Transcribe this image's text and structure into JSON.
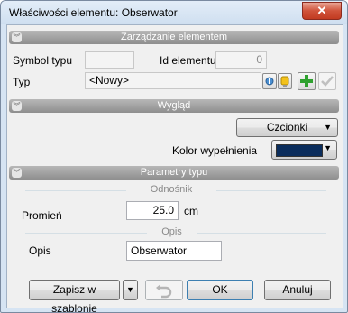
{
  "window": {
    "title": "Właściwości elementu: Obserwator",
    "close_symbol": "✕"
  },
  "sections": {
    "management": "Zarządzanie elementem",
    "appearance": "Wygląd",
    "params": "Parametry typu"
  },
  "management": {
    "type_symbol_label": "Symbol typu",
    "type_symbol_value": "",
    "element_id_label": "Id elementu",
    "element_id_value": "0",
    "type_label": "Typ",
    "type_value": "<Nowy>"
  },
  "appearance": {
    "fonts_button": "Czcionki",
    "fill_color_label": "Kolor wypełnienia",
    "fill_color": "#0b2d5c"
  },
  "params": {
    "reference_group": "Odnośnik",
    "radius_label": "Promień",
    "radius_value": "25.0",
    "radius_unit": "cm",
    "description_group": "Opis",
    "description_label": "Opis",
    "description_value": "Obserwator"
  },
  "footer": {
    "save_template": "Zapisz w szablonie",
    "ok": "OK",
    "cancel": "Anuluj"
  },
  "colors": {
    "plus_icon": "#2fa12f",
    "accent_border": "#3c7fb1"
  }
}
